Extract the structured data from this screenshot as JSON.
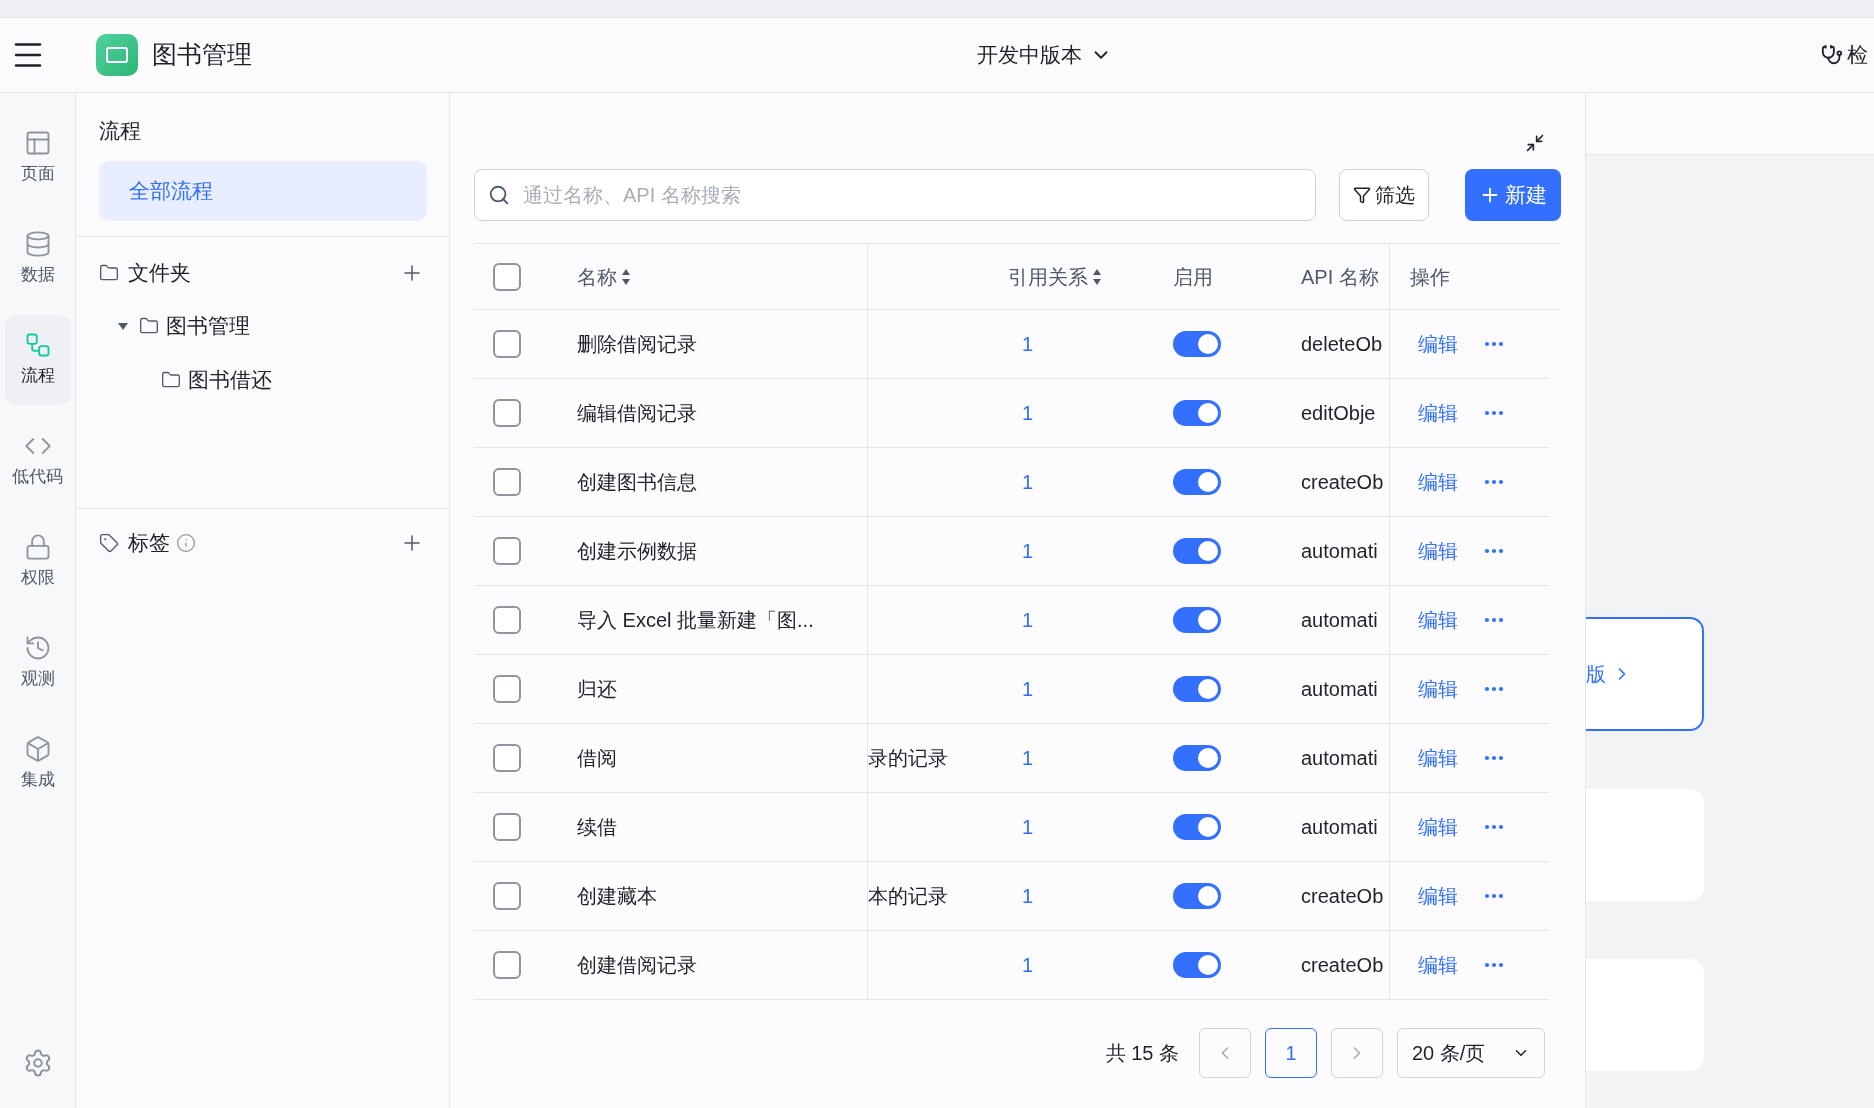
{
  "top_bar": {
    "app_title": "图书管理",
    "version": "开发中版本",
    "right_action": "检"
  },
  "nav_rail": {
    "items": [
      {
        "label": "页面",
        "selected": false
      },
      {
        "label": "数据",
        "selected": false
      },
      {
        "label": "流程",
        "selected": true
      },
      {
        "label": "低代码",
        "selected": false
      },
      {
        "label": "权限",
        "selected": false
      },
      {
        "label": "观测",
        "selected": false
      },
      {
        "label": "集成",
        "selected": false
      }
    ]
  },
  "flow_panel": {
    "title": "流程",
    "all_flows": {
      "label": "全部流程",
      "selected": true
    },
    "folders": {
      "title": "文件夹",
      "tree": [
        {
          "label": "图书管理",
          "expanded": true,
          "children": [
            {
              "label": "图书借还"
            }
          ]
        }
      ]
    },
    "tags": {
      "title": "标签"
    }
  },
  "table": {
    "search": {
      "placeholder": "通过名称、API 名称搜索"
    },
    "filter_button": "筛选",
    "new_button": "新建",
    "select_all_checked": false,
    "columns": [
      "名称",
      "引用关系",
      "启用",
      "API 名称",
      "操作"
    ],
    "rows": [
      {
        "checked": false,
        "name": "删除借阅记录",
        "refs": "1",
        "enabled": true,
        "api": "deleteOb",
        "edit": "编辑"
      },
      {
        "checked": false,
        "name": "编辑借阅记录",
        "refs": "1",
        "enabled": true,
        "api": "editObje",
        "edit": "编辑"
      },
      {
        "checked": false,
        "name": "创建图书信息",
        "refs": "1",
        "enabled": true,
        "api": "createOb",
        "edit": "编辑"
      },
      {
        "checked": false,
        "name": "创建示例数据",
        "refs": "1",
        "enabled": true,
        "api": "automati",
        "edit": "编辑"
      },
      {
        "checked": false,
        "name": "导入 Excel 批量新建「图...",
        "refs": "1",
        "enabled": true,
        "api": "automati",
        "edit": "编辑"
      },
      {
        "checked": false,
        "name": "归还",
        "refs": "1",
        "enabled": true,
        "api": "automati",
        "edit": "编辑"
      },
      {
        "checked": false,
        "name": "借阅",
        "column_3": "录的记录",
        "refs": "1",
        "enabled": true,
        "api": "automati",
        "edit": "编辑"
      },
      {
        "checked": false,
        "name": "续借",
        "refs": "1",
        "enabled": true,
        "api": "automati",
        "edit": "编辑"
      },
      {
        "checked": false,
        "name": "创建藏本",
        "column_3": "本的记录",
        "refs": "1",
        "enabled": true,
        "api": "createOb",
        "edit": "编辑"
      },
      {
        "checked": false,
        "name": "创建借阅记录",
        "refs": "1",
        "enabled": true,
        "api": "createOb",
        "edit": "编辑"
      }
    ]
  },
  "pagination": {
    "total": "共 15 条",
    "pages": [
      {
        "label": "1",
        "selected": true
      }
    ],
    "page_size": "20 条/页"
  },
  "background": {
    "card_link": "版"
  }
}
